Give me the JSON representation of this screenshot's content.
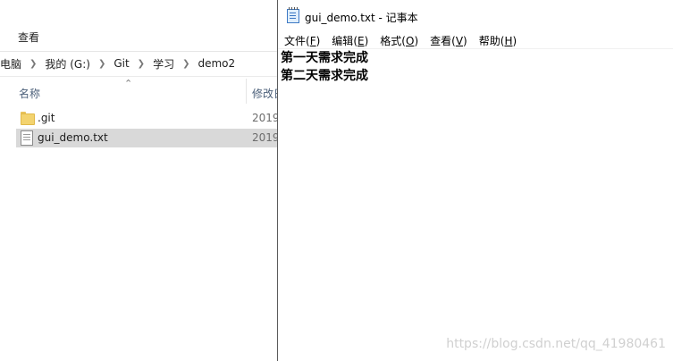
{
  "explorer": {
    "ribbon_tab_view": "查看",
    "breadcrumbs": [
      "电脑",
      "我的 (G:)",
      "Git",
      "学习",
      "demo2"
    ],
    "columns": {
      "name": "名称",
      "modified": "修改日"
    },
    "files": [
      {
        "name": ".git",
        "type": "folder",
        "date": "2019"
      },
      {
        "name": "gui_demo.txt",
        "type": "text",
        "date": "2019",
        "selected": true
      }
    ],
    "colors": {
      "selected_row": "#d9d9d9",
      "header_text": "#4c607a"
    }
  },
  "notepad": {
    "title": "gui_demo.txt - 记事本",
    "menu": [
      {
        "label": "文件",
        "key": "F"
      },
      {
        "label": "编辑",
        "key": "E"
      },
      {
        "label": "格式",
        "key": "O"
      },
      {
        "label": "查看",
        "key": "V"
      },
      {
        "label": "帮助",
        "key": "H"
      }
    ],
    "content_lines": [
      "第一天需求完成",
      "第二天需求完成"
    ]
  },
  "watermark": "https://blog.csdn.net/qq_41980461"
}
